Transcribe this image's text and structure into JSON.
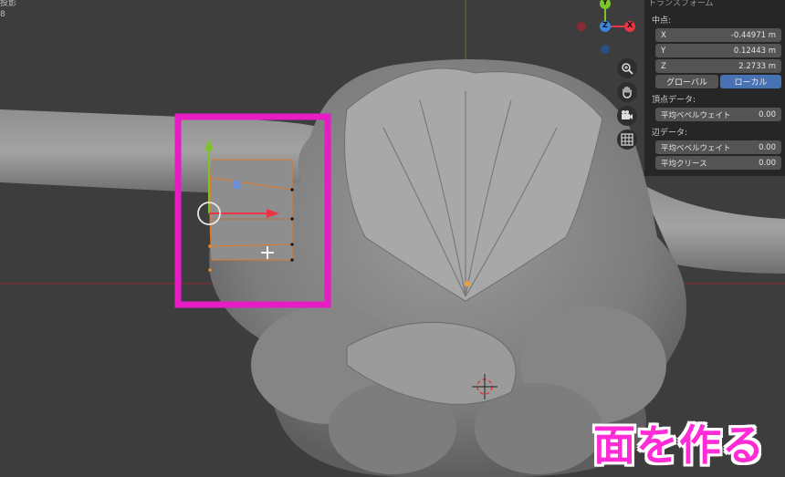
{
  "viewport_label_top": "投影",
  "viewport_label_second": "8",
  "panel": {
    "title": "トランスフォーム",
    "median_label": "中点:",
    "x": {
      "label": "X",
      "value": "-0.44971 m"
    },
    "y": {
      "label": "Y",
      "value": "0.12443 m"
    },
    "z": {
      "label": "Z",
      "value": "2.2733 m"
    },
    "global_label": "グローバル",
    "local_label": "ローカル",
    "vertex_data_label": "頂点データ:",
    "vertex_bevel_label": "平均ベベルウェイト",
    "vertex_bevel_value": "0.00",
    "edge_data_label": "辺データ:",
    "edge_bevel_label": "平均ベベルウェイト",
    "edge_bevel_value": "0.00",
    "edge_crease_label": "平均クリース",
    "edge_crease_value": "0.00"
  },
  "gizmo": {
    "x_label": "X",
    "y_label": "Y",
    "z_label": "Z"
  },
  "caption": "面を作る",
  "colors": {
    "highlight": "#e81cc4",
    "caption": "#ff2bd6",
    "active_toggle": "#4772b3",
    "x_axis": "#ee3344",
    "y_axis": "#7dc42a",
    "z_axis": "#3b86e0"
  },
  "icons": [
    "zoom-icon",
    "hand-icon",
    "camera-icon",
    "grid-icon"
  ]
}
